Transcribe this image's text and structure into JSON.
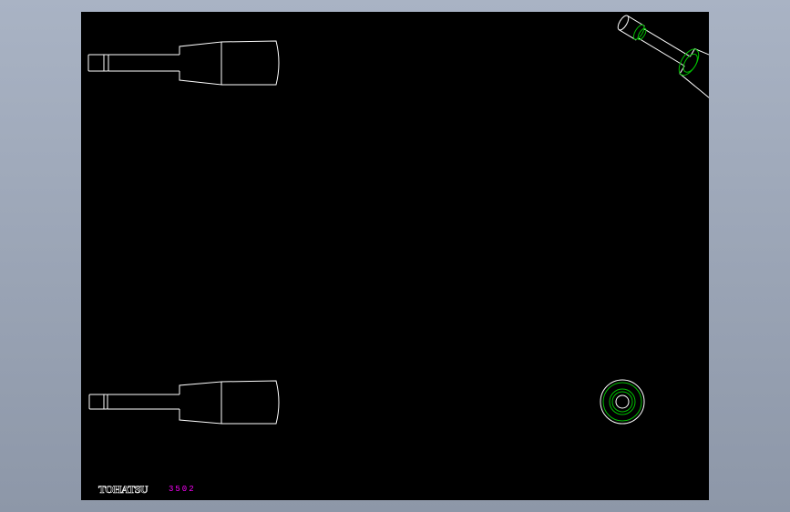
{
  "drawing": {
    "brand": "TOHATSU",
    "part_number": "3502"
  },
  "colors": {
    "background_outer": "#9aa4b5",
    "canvas": "#000000",
    "outline": "#ffffff",
    "hidden_circle": "#00c000",
    "part_number": "#ff00ff"
  },
  "views": [
    "front-view-handle",
    "top-view-handle",
    "isometric-view-handle",
    "end-view-handle"
  ]
}
